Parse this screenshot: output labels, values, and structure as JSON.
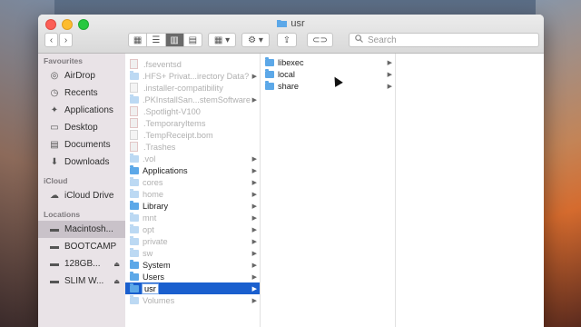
{
  "window": {
    "title": "usr"
  },
  "toolbar": {
    "back_icon": "‹",
    "forward_icon": "›",
    "view_icons": [
      "▦",
      "☰",
      "▥",
      "▤"
    ],
    "arrange_icon": "▦ ▾",
    "action_icon": "⚙ ▾",
    "share_icon": "⇪",
    "tags_icon": "⊂⊃",
    "search_placeholder": "Search"
  },
  "sidebar": {
    "favourites_header": "Favourites",
    "favourites": [
      {
        "label": "AirDrop",
        "icon": "airdrop-icon"
      },
      {
        "label": "Recents",
        "icon": "recents-icon"
      },
      {
        "label": "Applications",
        "icon": "applications-icon"
      },
      {
        "label": "Desktop",
        "icon": "desktop-icon"
      },
      {
        "label": "Documents",
        "icon": "documents-icon"
      },
      {
        "label": "Downloads",
        "icon": "downloads-icon"
      }
    ],
    "icloud_header": "iCloud",
    "icloud": [
      {
        "label": "iCloud Drive",
        "icon": "cloud-icon"
      }
    ],
    "locations_header": "Locations",
    "locations": [
      {
        "label": "Macintosh...",
        "icon": "disk-icon",
        "selected": true
      },
      {
        "label": "BOOTCAMP",
        "icon": "disk-icon"
      },
      {
        "label": "128GB...",
        "icon": "disk-icon",
        "eject": "⏏"
      },
      {
        "label": "SLIM W...",
        "icon": "disk-icon",
        "eject": "⏏"
      }
    ]
  },
  "column1": [
    {
      "name": ".fseventsd",
      "kind": "file-red",
      "dim": true
    },
    {
      "name": ".HFS+ Privat...irectory Data?",
      "kind": "folder-dim",
      "dim": true,
      "chev": "▶"
    },
    {
      "name": ".installer-compatibility",
      "kind": "file-doc",
      "dim": true
    },
    {
      "name": ".PKInstallSan...stemSoftware",
      "kind": "folder-dim",
      "dim": true,
      "chev": "▶"
    },
    {
      "name": ".Spotlight-V100",
      "kind": "file-red",
      "dim": true
    },
    {
      "name": ".TemporaryItems",
      "kind": "file-red",
      "dim": true
    },
    {
      "name": ".TempReceipt.bom",
      "kind": "file-doc",
      "dim": true
    },
    {
      "name": ".Trashes",
      "kind": "file-red",
      "dim": true
    },
    {
      "name": ".vol",
      "kind": "folder-dim",
      "dim": true,
      "chev": "▶"
    },
    {
      "name": "Applications",
      "kind": "folder-blue",
      "dim": false,
      "chev": "▶"
    },
    {
      "name": "cores",
      "kind": "folder-dim",
      "dim": true,
      "chev": "▶"
    },
    {
      "name": "home",
      "kind": "folder-dim",
      "dim": true,
      "chev": "▶"
    },
    {
      "name": "Library",
      "kind": "folder-blue",
      "dim": false,
      "chev": "▶"
    },
    {
      "name": "mnt",
      "kind": "folder-dim",
      "dim": true,
      "chev": "▶"
    },
    {
      "name": "opt",
      "kind": "folder-dim",
      "dim": true,
      "chev": "▶"
    },
    {
      "name": "private",
      "kind": "folder-dim",
      "dim": true,
      "chev": "▶"
    },
    {
      "name": "sw",
      "kind": "folder-dim",
      "dim": true,
      "chev": "▶"
    },
    {
      "name": "System",
      "kind": "folder-blue",
      "dim": false,
      "chev": "▶"
    },
    {
      "name": "Users",
      "kind": "folder-blue",
      "dim": false,
      "chev": "▶"
    },
    {
      "name": "usr",
      "kind": "folder-blue",
      "dim": false,
      "chev": "▶",
      "selected": true
    },
    {
      "name": "Volumes",
      "kind": "folder-dim",
      "dim": true,
      "chev": "▶"
    }
  ],
  "column2": [
    {
      "name": "libexec",
      "kind": "folder-blue",
      "chev": "▶"
    },
    {
      "name": "local",
      "kind": "folder-blue",
      "chev": "▶"
    },
    {
      "name": "share",
      "kind": "folder-blue",
      "chev": "▶"
    }
  ],
  "colors": {
    "selection": "#1a5fce",
    "folder": "#5ca8e8"
  }
}
